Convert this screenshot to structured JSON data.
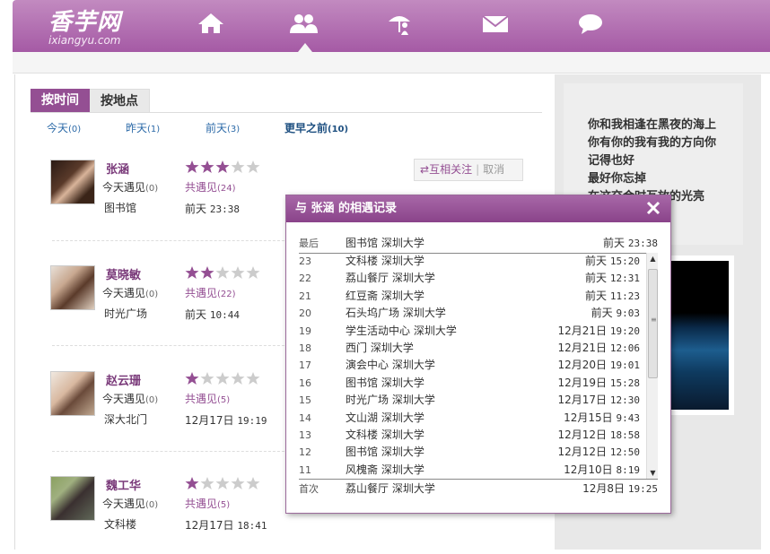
{
  "header": {
    "logo": "香芋网",
    "logo_sub": "ixiangyu.com",
    "nav_icons": [
      "home-icon",
      "friends-icon",
      "umbrella-person-icon",
      "mail-icon",
      "chat-bubble-icon"
    ]
  },
  "tabs": [
    {
      "label": "按时间",
      "active": true
    },
    {
      "label": "按地点",
      "active": false
    }
  ],
  "filters": [
    {
      "label": "今天",
      "count": "(0)"
    },
    {
      "label": "昨天",
      "count": "(1)"
    },
    {
      "label": "前天",
      "count": "(3)"
    },
    {
      "label": "更早之前",
      "count": "(10)"
    }
  ],
  "users": [
    {
      "name": "张涵",
      "met_label": "今天遇见",
      "met_count": "(0)",
      "place": "图书馆",
      "stars": 3,
      "together_label": "共遇见",
      "together_count": "(24)",
      "day": "前天",
      "time": "23:38"
    },
    {
      "name": "莫晓敏",
      "met_label": "今天遇见",
      "met_count": "(0)",
      "place": "时光广场",
      "stars": 2,
      "together_label": "共遇见",
      "together_count": "(22)",
      "day": "前天",
      "time": "10:44"
    },
    {
      "name": "赵云珊",
      "met_label": "今天遇见",
      "met_count": "(0)",
      "place": "深大北门",
      "stars": 1,
      "together_label": "共遇见",
      "together_count": "(5)",
      "day": "12月17日",
      "time": "19:19"
    },
    {
      "name": "魏工华",
      "met_label": "今天遇见",
      "met_count": "(0)",
      "place": "文科楼",
      "stars": 1,
      "together_label": "共遇见",
      "together_count": "(5)",
      "day": "12月17日",
      "time": "18:41"
    }
  ],
  "follow": {
    "mutual": "互相关注",
    "cancel": "取消"
  },
  "poem": [
    "你和我相逢在黑夜的海上",
    "你有你的我有我的方向你",
    "记得也好",
    "最好你忘掉",
    "在这交会时互放的光亮"
  ],
  "dialog": {
    "title": "与  张涵  的相遇记录",
    "latest": {
      "n": "最后",
      "place": "图书馆  深圳大学",
      "day": "前天",
      "time": "23:38"
    },
    "rows": [
      {
        "n": "23",
        "place": "文科楼  深圳大学",
        "day": "前天",
        "time": "15:20"
      },
      {
        "n": "22",
        "place": "荔山餐厅  深圳大学",
        "day": "前天",
        "time": "12:31"
      },
      {
        "n": "21",
        "place": "红豆斋  深圳大学",
        "day": "前天",
        "time": "11:23"
      },
      {
        "n": "20",
        "place": "石头坞广场  深圳大学",
        "day": "前天",
        "time": " 9:03"
      },
      {
        "n": "19",
        "place": "学生活动中心  深圳大学",
        "day": "12月21日",
        "time": "19:20"
      },
      {
        "n": "18",
        "place": "西门  深圳大学",
        "day": "12月21日",
        "time": "12:06"
      },
      {
        "n": "17",
        "place": "演会中心  深圳大学",
        "day": "12月20日",
        "time": "19:01"
      },
      {
        "n": "16",
        "place": "图书馆  深圳大学",
        "day": "12月19日",
        "time": "15:28"
      },
      {
        "n": "15",
        "place": "时光广场  深圳大学",
        "day": "12月17日",
        "time": "12:30"
      },
      {
        "n": "14",
        "place": "文山湖  深圳大学",
        "day": "12月15日",
        "time": " 9:43"
      },
      {
        "n": "13",
        "place": "文科楼  深圳大学",
        "day": "12月12日",
        "time": "18:58"
      },
      {
        "n": "12",
        "place": "图书馆  深圳大学",
        "day": "12月12日",
        "time": "12:50"
      },
      {
        "n": "11",
        "place": "风槐斋  深圳大学",
        "day": "12月10日",
        "time": " 8:19"
      }
    ],
    "first": {
      "n": "首次",
      "place": "荔山餐厅  深圳大学",
      "day": "12月8日",
      "time": "19:25"
    }
  },
  "colors": {
    "brand": "#944f93",
    "link": "#2c6aa8",
    "star_on": "#944f93",
    "star_off": "#cccccc"
  }
}
